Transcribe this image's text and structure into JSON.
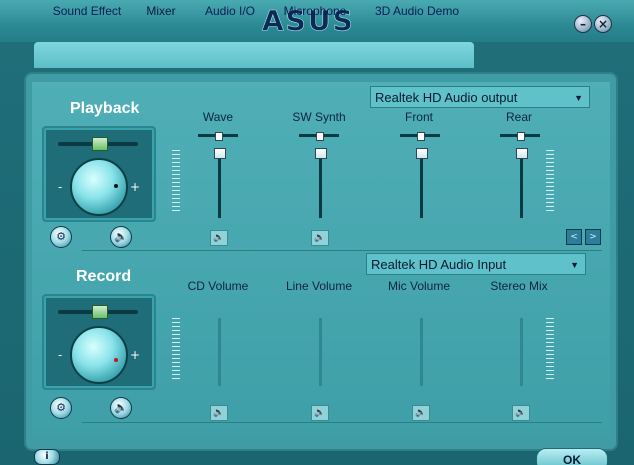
{
  "header": {
    "logo_text": "ASUS",
    "minimize_label": "–",
    "close_label": "×"
  },
  "tabs": [
    {
      "label": "Sound Effect"
    },
    {
      "label": "Mixer"
    },
    {
      "label": "Audio I/O"
    },
    {
      "label": "Microphone"
    },
    {
      "label": "3D Audio Demo"
    }
  ],
  "playback": {
    "title": "Playback",
    "minus": "-",
    "plus": "+",
    "output_device": "Realtek HD Audio output",
    "channels": [
      {
        "label": "Wave"
      },
      {
        "label": "SW Synth"
      },
      {
        "label": "Front"
      },
      {
        "label": "Rear"
      }
    ]
  },
  "record": {
    "title": "Record",
    "minus": "-",
    "plus": "+",
    "input_device": "Realtek HD Audio Input",
    "channels": [
      {
        "label": "CD Volume"
      },
      {
        "label": "Line Volume"
      },
      {
        "label": "Mic Volume"
      },
      {
        "label": "Stereo Mix"
      }
    ]
  },
  "footer": {
    "info_label": "i",
    "ok_label": "OK"
  },
  "icons": {
    "speaker": "🔈",
    "settings": "⚙",
    "prev": "<",
    "next": ">",
    "arrow_down": "▼"
  },
  "colors": {
    "accent": "#5fc1c9",
    "panel": "#3f9ba4",
    "header": "#2c8a94"
  }
}
